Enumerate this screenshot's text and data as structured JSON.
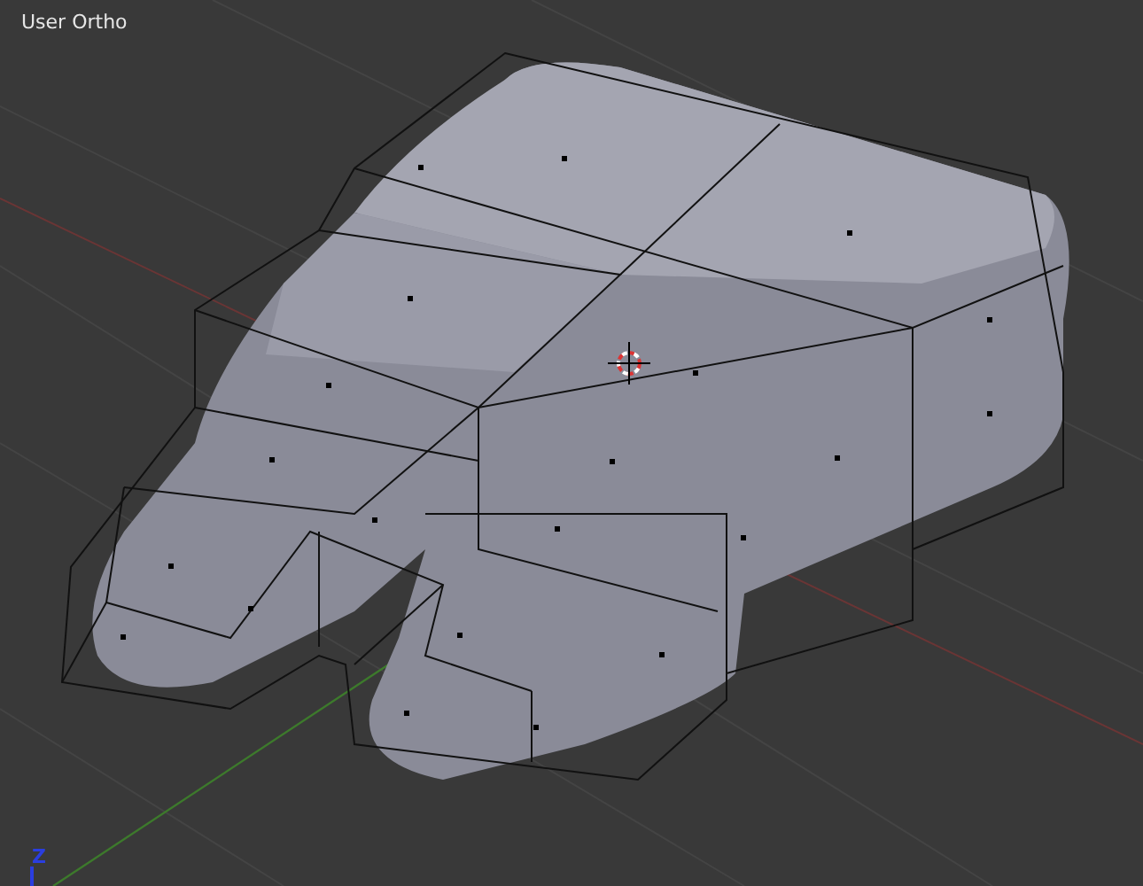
{
  "viewport": {
    "view_label": "User Ortho",
    "axis_label": "Z"
  }
}
